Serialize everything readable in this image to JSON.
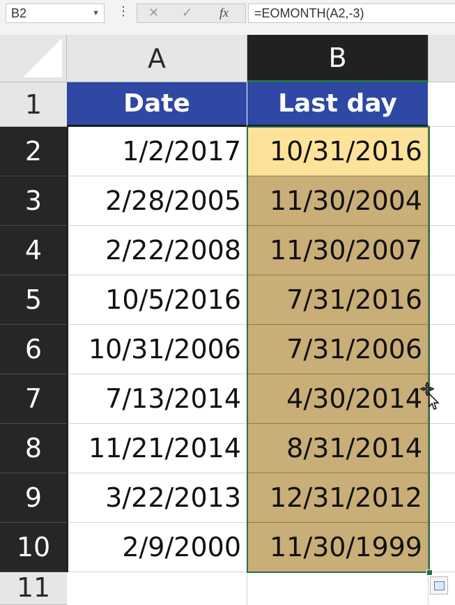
{
  "formula_bar": {
    "name_box": "B2",
    "dots": "⋮",
    "cancel": "✕",
    "enter": "✓",
    "fx": "fx",
    "formula": "=EOMONTH(A2,-3)"
  },
  "columns": [
    "A",
    "B"
  ],
  "rows": [
    "1",
    "2",
    "3",
    "4",
    "5",
    "6",
    "7",
    "8",
    "9",
    "10",
    "11"
  ],
  "headers": {
    "a": "Date",
    "b": "Last day"
  },
  "data": [
    {
      "a": "1/2/2017",
      "b": "10/31/2016"
    },
    {
      "a": "2/28/2005",
      "b": "11/30/2004"
    },
    {
      "a": "2/22/2008",
      "b": "11/30/2007"
    },
    {
      "a": "10/5/2016",
      "b": "7/31/2016"
    },
    {
      "a": "10/31/2006",
      "b": "7/31/2006"
    },
    {
      "a": "7/13/2014",
      "b": "4/30/2014"
    },
    {
      "a": "11/21/2014",
      "b": "8/31/2014"
    },
    {
      "a": "3/22/2013",
      "b": "12/31/2012"
    },
    {
      "a": "2/9/2000",
      "b": "11/30/1999"
    }
  ],
  "colors": {
    "header_blue": "#2e48a4",
    "fill_tan": "#c9ae78",
    "active_yellow": "#fde39a",
    "selection_green": "#217346"
  }
}
